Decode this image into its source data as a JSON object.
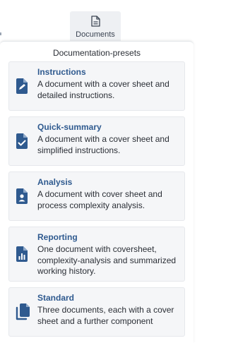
{
  "toolbar": {
    "documents_tab": {
      "label": "Documents",
      "icon": "document-icon"
    }
  },
  "panel": {
    "title": "Documentation-presets",
    "presets": [
      {
        "title": "Instructions",
        "description": "A document with a cover sheet and detailed instructions.",
        "icon": "document-edit-icon"
      },
      {
        "title": "Quick-summary",
        "description": "A document with a cover sheet and simplified instructions.",
        "icon": "document-check-icon"
      },
      {
        "title": "Analysis",
        "description": "A document with cover sheet and process complexity analysis.",
        "icon": "document-user-icon"
      },
      {
        "title": "Reporting",
        "description": "One document with coversheet, complexity-analysis and summarized working history.",
        "icon": "document-chart-icon"
      },
      {
        "title": "Standard",
        "description": "Three documents, each with a cover sheet and a further component",
        "icon": "documents-stack-icon"
      }
    ]
  },
  "colors": {
    "accent": "#2f5a8f",
    "card_background": "#f5f6f8",
    "tab_background": "#eef0f3"
  }
}
